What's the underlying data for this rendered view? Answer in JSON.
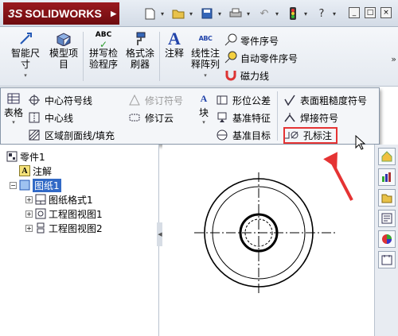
{
  "titlebar": {
    "logo_text": "SOLIDWORKS",
    "logo_prefix": "3S",
    "qat_icons": [
      "new-icon",
      "open-icon",
      "save-icon",
      "print-icon",
      "undo-icon",
      "rebuild-icon",
      "help-icon"
    ],
    "help_glyph": "?",
    "window_controls": [
      "_",
      "□",
      "×"
    ]
  },
  "ribbon": {
    "smart_dimension": "智能尺\n寸",
    "model_items": "模型项\n目",
    "spell_checker": "拼写检\n验程序",
    "format_painter": "格式涂\n刷器",
    "note": "注释",
    "linear_note_pattern": "线性注\n释阵列",
    "balloon": "零件序号",
    "auto_balloon": "自动零件序号",
    "magnetic_line": "磁力线",
    "abc": "ABC",
    "abc2": "ABC"
  },
  "flyout": {
    "table": "表格",
    "center_mark": "中心符号线",
    "centerline": "中心线",
    "area_hatch": "区域剖面线/填充",
    "revision_symbol": "修订符号",
    "revision_cloud": "修订云",
    "block": "块",
    "gtol": "形位公差",
    "datum_feature": "基准特征",
    "datum_target": "基准目标",
    "surface_finish": "表面粗糙度符号",
    "weld_symbol": "焊接符号",
    "hole_callout": "孔标注"
  },
  "tree": {
    "part": "零件1",
    "annotations": "注解",
    "sheet": "图纸1",
    "sheet_format": "图纸格式1",
    "drawing_view1": "工程图视图1",
    "drawing_view2": "工程图视图2"
  },
  "colors": {
    "accent_red": "#e53333",
    "selection_blue": "#3169c6"
  }
}
